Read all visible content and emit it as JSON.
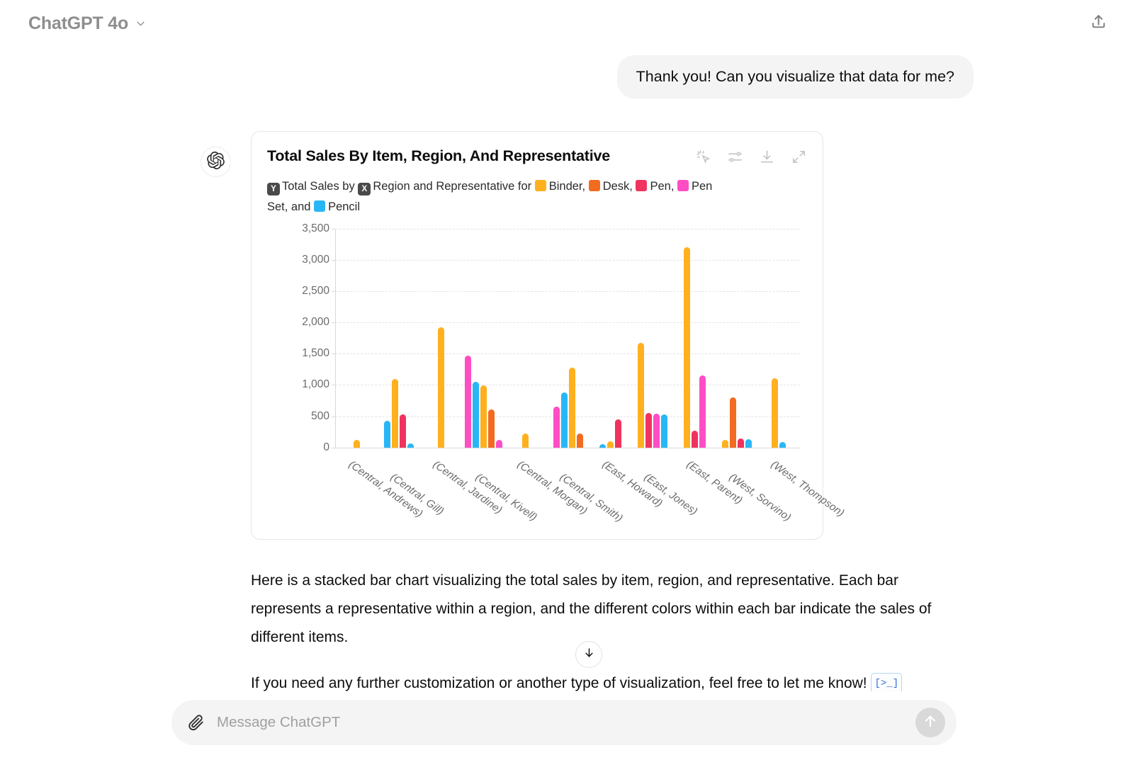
{
  "header": {
    "model_name": "ChatGPT 4o",
    "chevron_icon": "chevron-down-icon",
    "share_icon": "share-upload-icon"
  },
  "conversation": {
    "user_message": "Thank you! Can you visualize that data for me?",
    "assistant_avatar": "openai-logo-icon",
    "paragraph_1": "Here is a stacked bar chart visualizing the total sales by item, region, and representative. Each bar represents a representative within a region, and the different colors within each bar indicate the sales of different items.",
    "paragraph_2_before": "If you need any further customization or another type of visualization, feel free to let me know!",
    "code_badge": "[>_]"
  },
  "chart_card": {
    "title": "Total Sales By Item, Region, And Representative",
    "tools": [
      {
        "name": "magic-cursor-icon",
        "label": "Explore"
      },
      {
        "name": "chart-settings-icon",
        "label": "Settings"
      },
      {
        "name": "download-icon",
        "label": "Download"
      },
      {
        "name": "expand-icon",
        "label": "Expand"
      }
    ],
    "legend_text": {
      "y_badge": "Y",
      "part1": "Total Sales by",
      "x_badge": "X",
      "part2": "Region and Representative for",
      "sep_comma": ",",
      "sep_and": "and"
    }
  },
  "chart_data": {
    "type": "bar",
    "title": "Total Sales By Item, Region, And Representative",
    "xlabel": "",
    "ylabel": "Total Sales",
    "ylim": [
      0,
      3500
    ],
    "yticks": [
      "0",
      "500",
      "1,000",
      "1,500",
      "2,000",
      "2,500",
      "3,000",
      "3,500"
    ],
    "ytick_values": [
      0,
      500,
      1000,
      1500,
      2000,
      2500,
      3000,
      3500
    ],
    "grid": true,
    "legend_position": "top",
    "categories": [
      "(Central, Andrews)",
      "(Central, Gill)",
      "(Central, Jardine)",
      "(Central, Kivell)",
      "(Central, Morgan)",
      "(Central, Smith)",
      "(East, Howard)",
      "(East, Jones)",
      "(East, Parent)",
      "(West, Sorvino)",
      "(West, Thompson)"
    ],
    "series": [
      {
        "name": "Binder",
        "color": "#FFB01F",
        "values": [
          120,
          1100,
          1920,
          990,
          220,
          1280,
          95,
          1670,
          3200,
          120,
          1110
        ]
      },
      {
        "name": "Desk",
        "color": "#F26B21",
        "values": [
          0,
          0,
          0,
          610,
          0,
          220,
          0,
          0,
          0,
          800,
          0
        ]
      },
      {
        "name": "Pen",
        "color": "#F0335E",
        "values": [
          0,
          530,
          0,
          0,
          0,
          0,
          450,
          550,
          270,
          140,
          0
        ]
      },
      {
        "name": "Pen Set",
        "color": "#FF4DC4",
        "values": [
          0,
          0,
          0,
          1470,
          0,
          650,
          0,
          545,
          1150,
          0,
          0
        ]
      },
      {
        "name": "Pencil",
        "color": "#29B6F6",
        "values": [
          0,
          430,
          0,
          1050,
          0,
          880,
          55,
          535,
          0,
          130,
          85
        ]
      }
    ],
    "group_bar_order": [
      [
        "Binder"
      ],
      [
        "Pencil",
        "Binder",
        "Pen",
        "Pencil"
      ],
      [
        "Binder"
      ],
      [
        "Pen Set",
        "Pencil",
        "Binder",
        "Desk",
        "Pen Set"
      ],
      [
        "Binder"
      ],
      [
        "Pen Set",
        "Pencil",
        "Binder",
        "Desk"
      ],
      [
        "Pencil",
        "Binder",
        "Pen"
      ],
      [
        "Binder",
        "Pen",
        "Pen Set",
        "Pencil"
      ],
      [
        "Binder",
        "Pen",
        "Pen Set"
      ],
      [
        "Binder",
        "Desk",
        "Pen",
        "Pencil"
      ],
      [
        "Binder",
        "Pencil"
      ]
    ]
  },
  "composer": {
    "attach_icon": "paperclip-icon",
    "placeholder": "Message ChatGPT",
    "value": "",
    "send_icon": "send-arrow-up-icon"
  },
  "scroll_down_icon": "arrow-down-icon",
  "colors": {
    "binder": "#FFB01F",
    "desk": "#F26B21",
    "pen": "#F0335E",
    "pen_set": "#FF4DC4",
    "pencil": "#29B6F6"
  }
}
